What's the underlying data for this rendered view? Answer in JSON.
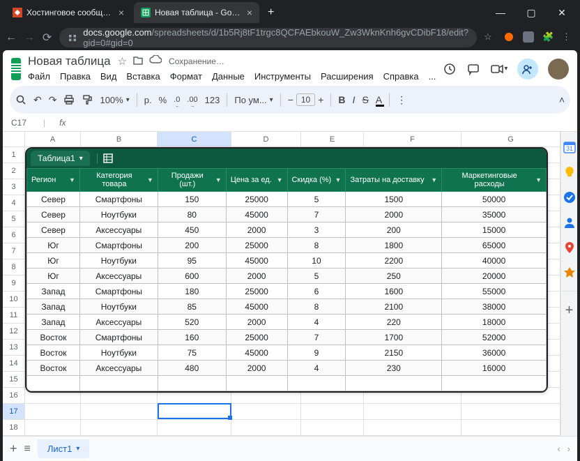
{
  "browser": {
    "tabs": [
      {
        "title": "Хостинговое сообщество «Tim",
        "active": false
      },
      {
        "title": "Новая таблица - Google Табли",
        "active": true
      }
    ],
    "url_host": "docs.google.com",
    "url_path": "/spreadsheets/d/1b5Rj8tF1trgc8QCFAEbkouW_Zw3WknKnh6gvCDibF18/edit?gid=0#gid=0"
  },
  "doc": {
    "title": "Новая таблица",
    "status": "Сохранение…"
  },
  "menu": [
    "Файл",
    "Правка",
    "Вид",
    "Вставка",
    "Формат",
    "Данные",
    "Инструменты",
    "Расширения",
    "Справка",
    "..."
  ],
  "toolbar": {
    "zoom": "100%",
    "currency_r": "р.",
    "percent": "%",
    "dec_dec": ".0",
    "dec_inc": ".00",
    "numformat": "123",
    "font": "По ум...",
    "font_size": "10"
  },
  "namebox": "C17",
  "columns": [
    "A",
    "B",
    "C",
    "D",
    "E",
    "F",
    "G"
  ],
  "active_col": "C",
  "active_row": 17,
  "table": {
    "name": "Таблица1",
    "headers": [
      "Регион",
      "Категория товара",
      "Продажи (шт.)",
      "Цена за ед.",
      "Скидка (%)",
      "Затраты на доставку",
      "Маркетинговые расходы"
    ],
    "rows": [
      [
        "Север",
        "Смартфоны",
        "150",
        "25000",
        "5",
        "1500",
        "50000"
      ],
      [
        "Север",
        "Ноутбуки",
        "80",
        "45000",
        "7",
        "2000",
        "35000"
      ],
      [
        "Север",
        "Аксессуары",
        "450",
        "2000",
        "3",
        "200",
        "15000"
      ],
      [
        "Юг",
        "Смартфоны",
        "200",
        "25000",
        "8",
        "1800",
        "65000"
      ],
      [
        "Юг",
        "Ноутбуки",
        "95",
        "45000",
        "10",
        "2200",
        "40000"
      ],
      [
        "Юг",
        "Аксессуары",
        "600",
        "2000",
        "5",
        "250",
        "20000"
      ],
      [
        "Запад",
        "Смартфоны",
        "180",
        "25000",
        "6",
        "1600",
        "55000"
      ],
      [
        "Запад",
        "Ноутбуки",
        "85",
        "45000",
        "8",
        "2100",
        "38000"
      ],
      [
        "Запад",
        "Аксессуары",
        "520",
        "2000",
        "4",
        "220",
        "18000"
      ],
      [
        "Восток",
        "Смартфоны",
        "160",
        "25000",
        "7",
        "1700",
        "52000"
      ],
      [
        "Восток",
        "Ноутбуки",
        "75",
        "45000",
        "9",
        "2150",
        "36000"
      ],
      [
        "Восток",
        "Аксессуары",
        "480",
        "2000",
        "4",
        "230",
        "16000"
      ]
    ]
  },
  "visible_row_count": 19,
  "sheet_tab": "Лист1",
  "side_colors": {
    "calendar": "#1a73e8",
    "keep": "#fbbc04",
    "tasks": "#1967d2",
    "contacts": "#1a73e8",
    "maps": "#ea4335",
    "drive": "#ea8600"
  }
}
